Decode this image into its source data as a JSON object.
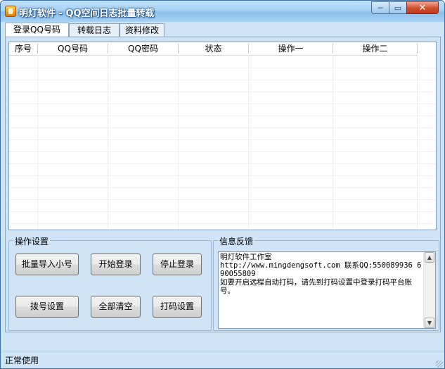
{
  "window": {
    "title": "明灯软件 - QQ空间日志批量转载",
    "min_glyph": "─",
    "max_glyph": "▭",
    "close_glyph": "✕"
  },
  "tabs": [
    {
      "label": "登录QQ号码",
      "active": true
    },
    {
      "label": "转载日志",
      "active": false
    },
    {
      "label": "资料修改",
      "active": false
    }
  ],
  "table": {
    "columns": [
      "序号",
      "QQ号码",
      "QQ密码",
      "状态",
      "操作一",
      "操作二"
    ],
    "rows": []
  },
  "ops_group": {
    "title": "操作设置",
    "buttons": {
      "batch_import": "批量导入小号",
      "start_login": "开始登录",
      "stop_login": "停止登录",
      "dial_settings": "拨号设置",
      "clear_all": "全部清空",
      "captcha_settings": "打码设置"
    }
  },
  "info_group": {
    "title": "信息反馈",
    "text": "明灯软件工作室\nhttp://www.mingdengsoft.com 联系QQ:550089936 690055809\n如要开启远程自动打码，请先到打码设置中登录打码平台账号。"
  },
  "status": {
    "text": "正常使用"
  },
  "icons": {
    "app": "app-flame-icon",
    "scroll_up": "▲",
    "scroll_down": "▼"
  }
}
